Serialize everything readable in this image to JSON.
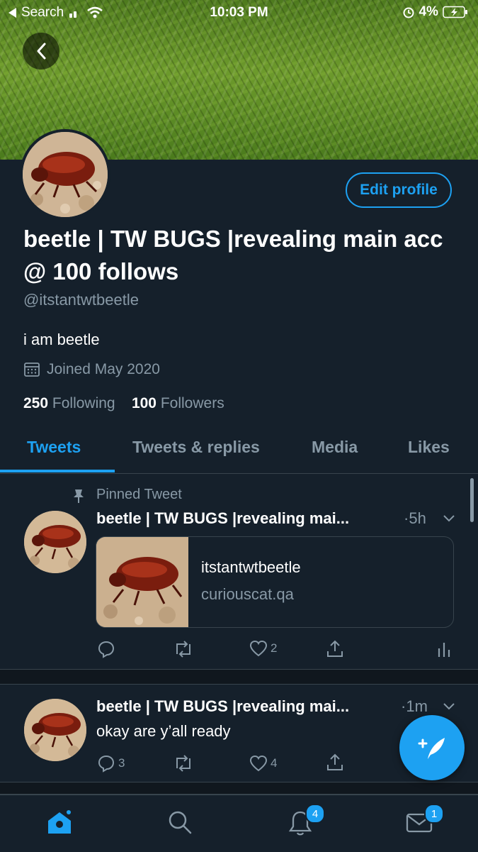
{
  "status_bar": {
    "back_label": "Search",
    "time": "10:03 PM",
    "battery": "4%"
  },
  "profile": {
    "display_name": "beetle | TW BUGS |revealing main acc @ 100 follows",
    "handle": "@itstantwtbeetle",
    "bio": "i am beetle",
    "joined": "Joined May 2020",
    "following_count": "250",
    "following_label": "Following",
    "followers_count": "100",
    "followers_label": "Followers",
    "edit_label": "Edit profile"
  },
  "tabs": [
    {
      "label": "Tweets",
      "active": true
    },
    {
      "label": "Tweets & replies"
    },
    {
      "label": "Media"
    },
    {
      "label": "Likes"
    }
  ],
  "tweets": [
    {
      "pinned_label": "Pinned Tweet",
      "name": "beetle | TW BUGS |revealing mai...",
      "time": "5h",
      "card": {
        "title": "itstantwtbeetle",
        "domain": "curiouscat.qa"
      },
      "likes": "2"
    },
    {
      "name": "beetle | TW BUGS |revealing mai...",
      "time": "1m",
      "text": "okay are y’all ready",
      "replies": "3",
      "likes": "4"
    }
  ],
  "bottom_nav": {
    "notifications_badge": "4",
    "messages_badge": "1"
  },
  "colors": {
    "background": "#15202b",
    "accent": "#1da1f2",
    "muted": "#8899a6",
    "border": "#38444d"
  }
}
